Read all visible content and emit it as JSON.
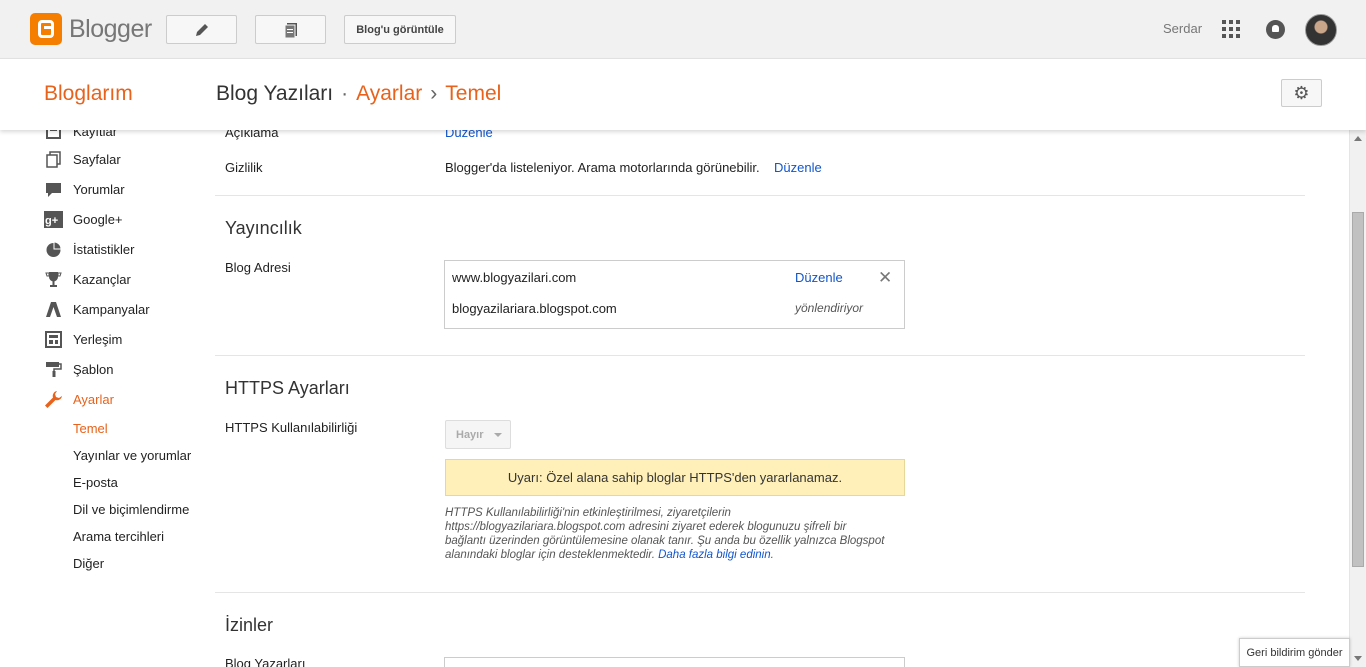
{
  "topbar": {
    "logo_text": "Blogger",
    "view_blog_label": "Blog'u görüntüle",
    "user_name": "Serdar"
  },
  "header": {
    "my_blogs": "Bloglarım",
    "breadcrumb": {
      "blog": "Blog Yazıları",
      "dot": "·",
      "settings": "Ayarlar",
      "chevron": "›",
      "basic": "Temel"
    }
  },
  "sidebar": {
    "items": [
      {
        "label": "Kayıtlar",
        "icon": "posts-icon"
      },
      {
        "label": "Sayfalar",
        "icon": "pages-icon"
      },
      {
        "label": "Yorumlar",
        "icon": "comment-icon"
      },
      {
        "label": "Google+",
        "icon": "google-plus-icon"
      },
      {
        "label": "İstatistikler",
        "icon": "pie-chart-icon"
      },
      {
        "label": "Kazançlar",
        "icon": "trophy-icon"
      },
      {
        "label": "Kampanyalar",
        "icon": "campaign-icon"
      },
      {
        "label": "Yerleşim",
        "icon": "layout-icon"
      },
      {
        "label": "Şablon",
        "icon": "paint-roller-icon"
      },
      {
        "label": "Ayarlar",
        "icon": "wrench-icon"
      }
    ],
    "subitems": [
      "Temel",
      "Yayınlar ve yorumlar",
      "E-posta",
      "Dil ve biçimlendirme",
      "Arama tercihleri",
      "Diğer"
    ]
  },
  "main": {
    "description_label": "Açıklama",
    "description_edit": "Düzenle",
    "privacy_label": "Gizlilik",
    "privacy_value": "Blogger'da listeleniyor. Arama motorlarında görünebilir.",
    "privacy_edit": "Düzenle",
    "publishing_title": "Yayıncılık",
    "blog_address_label": "Blog Adresi",
    "address_custom": "www.blogyazilari.com",
    "address_edit": "Düzenle",
    "address_blogspot": "blogyazilariara.blogspot.com",
    "address_redirect": "yönlendiriyor",
    "https_title": "HTTPS Ayarları",
    "https_avail_label": "HTTPS Kullanılabilirliği",
    "https_select_value": "Hayır",
    "https_warning": "Uyarı: Özel alana sahip bloglar HTTPS'den yararlanamaz.",
    "https_help": "HTTPS Kullanılabilirliği'nin etkinleştirilmesi, ziyaretçilerin https://blogyazilariara.blogspot.com adresini ziyaret ederek blogunuzu şifreli bir bağlantı üzerinden görüntülemesine olanak tanır. Şu anda bu özellik yalnızca Blogspot alanındaki bloglar için desteklenmektedir.",
    "https_help_link": "Daha fazla bilgi edinin",
    "permissions_title": "İzinler",
    "blog_authors_label": "Blog Yazarları"
  },
  "feedback_label": "Geri bildirim gönder",
  "colors": {
    "accent": "#e8621b",
    "link": "#1155cc",
    "warning_bg": "#fff0ba"
  }
}
